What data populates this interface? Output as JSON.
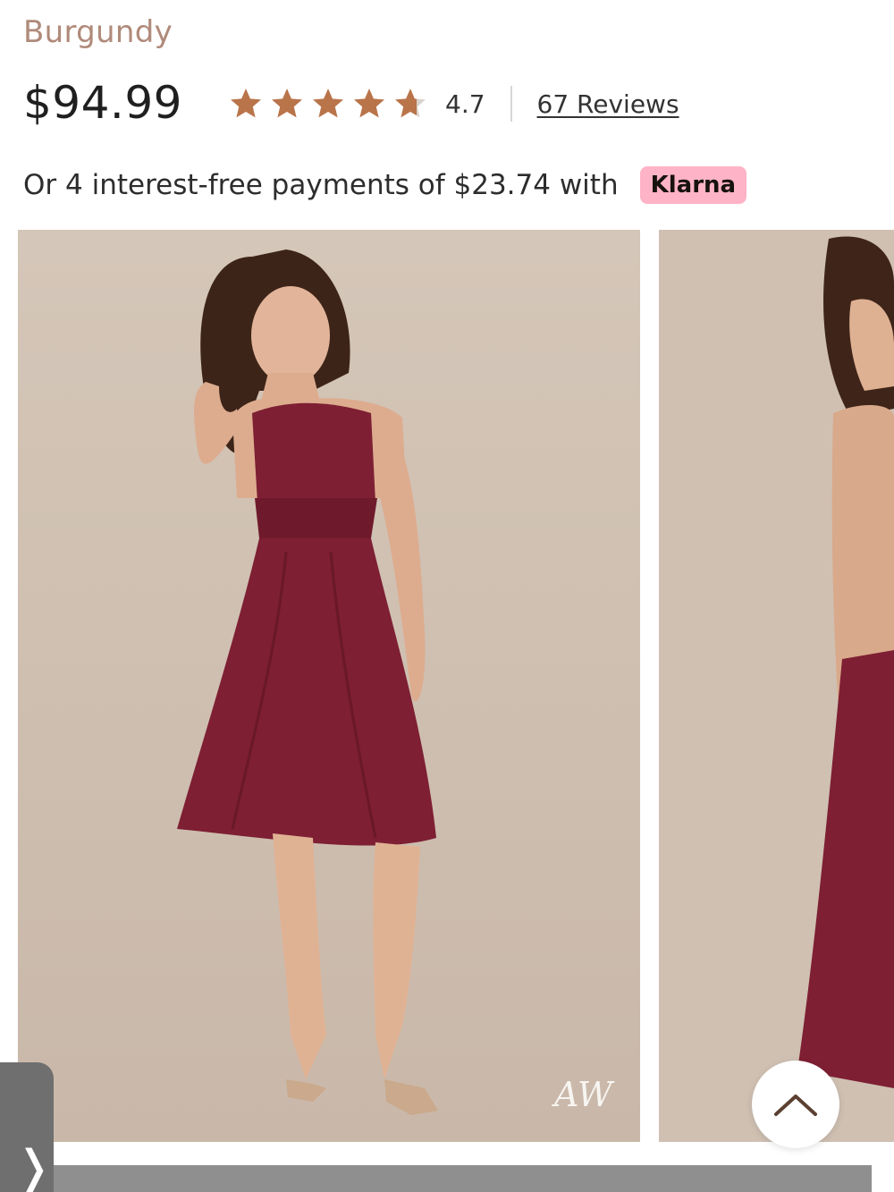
{
  "product": {
    "color_name": "Burgundy",
    "price": "$94.99",
    "rating": 4.7,
    "rating_text": "4.7",
    "reviews_link": "67 Reviews",
    "star_color": "#b9744a",
    "star_empty_color": "#d9d2cc"
  },
  "payment": {
    "installment_text": "Or 4 interest-free payments of $23.74 with",
    "provider_badge": "Klarna",
    "badge_color": "#ffb3c7"
  },
  "gallery": {
    "images": [
      {
        "description": "model-front-view",
        "dress_color": "#7e1f33"
      },
      {
        "description": "model-back-view",
        "dress_color": "#7e1f33"
      }
    ],
    "watermark": "AW"
  },
  "controls": {
    "scroll_top_icon": "chevron-up-icon",
    "side_tab_icon": "chevron-right-icon",
    "side_tab_glyph": "❭"
  }
}
